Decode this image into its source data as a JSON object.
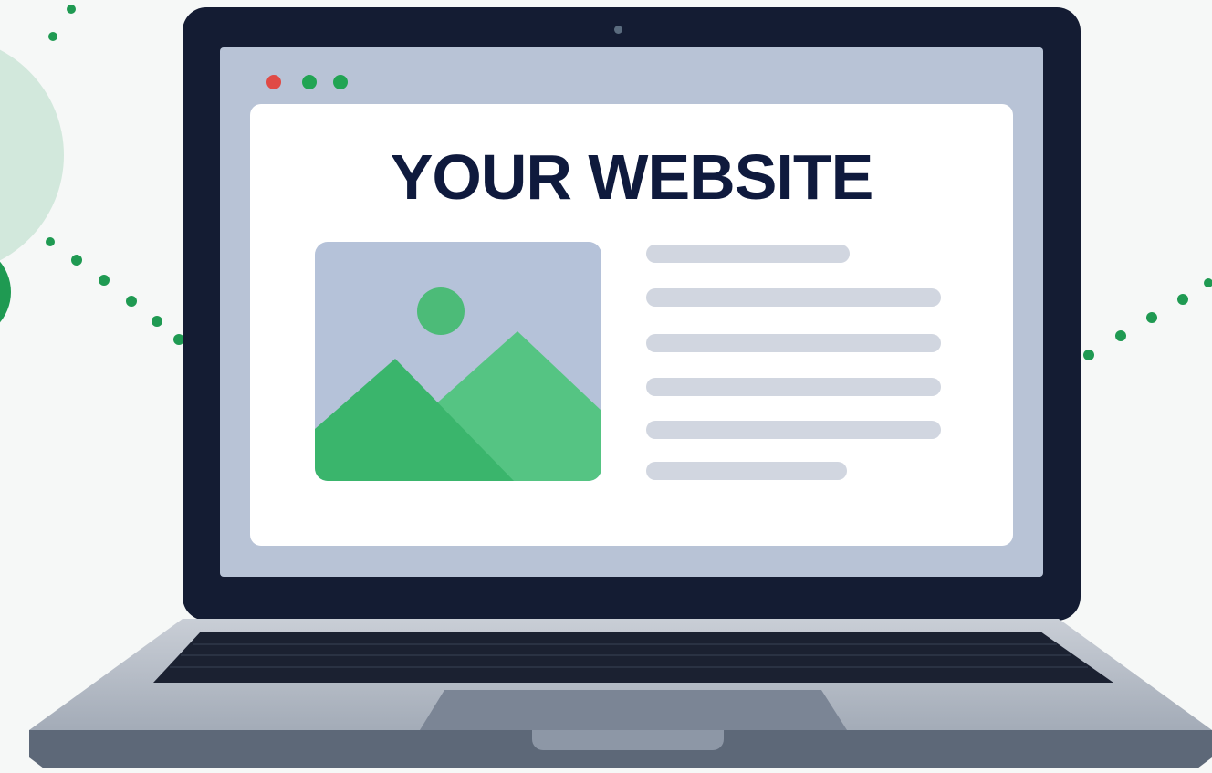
{
  "website": {
    "title": "YOUR WEBSITE"
  },
  "window_controls": [
    {
      "name": "close",
      "color": "#e04a45"
    },
    {
      "name": "minimize",
      "color": "#21a453"
    },
    {
      "name": "maximize",
      "color": "#21a453"
    }
  ],
  "colors": {
    "accent_green": "#2aa85e",
    "title_navy": "#0f1a3d",
    "bezel": "#141c33"
  },
  "icons": [
    "image-placeholder-icon",
    "laptop-camera-icon",
    "dotted-connector-lines"
  ]
}
